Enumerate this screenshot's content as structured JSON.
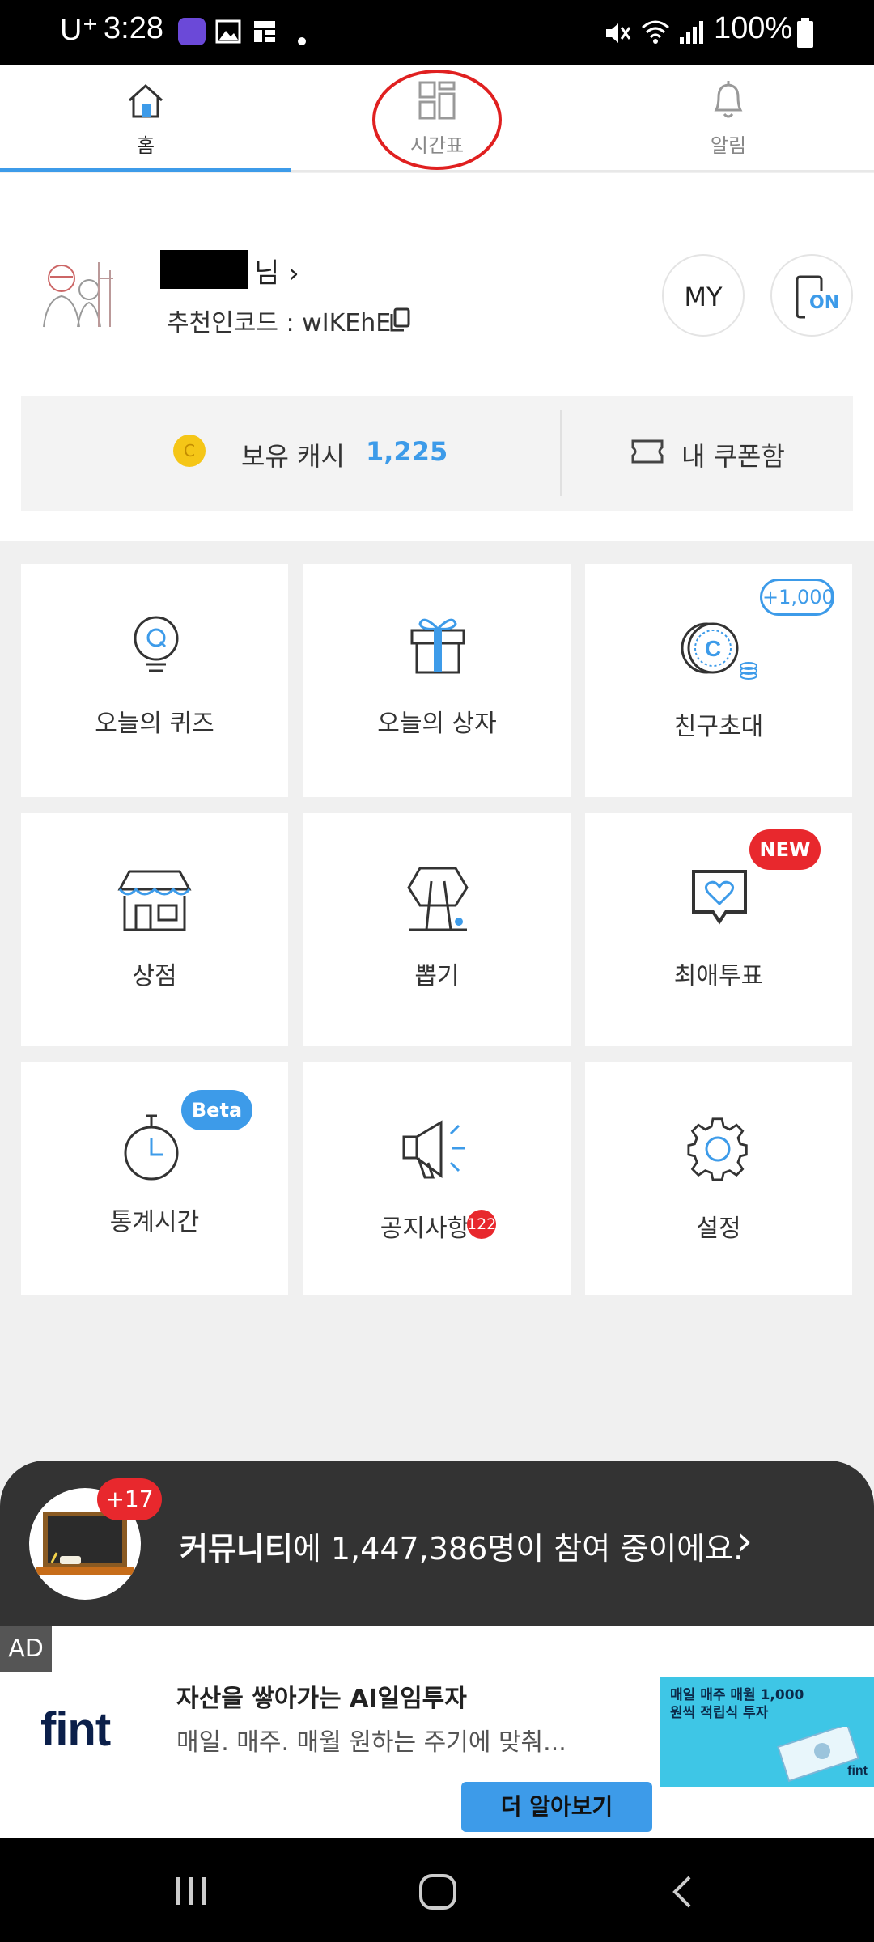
{
  "status_bar": {
    "carrier": "U⁺",
    "time": "3:28",
    "battery": "100%"
  },
  "tabs": [
    {
      "label": "홈",
      "icon": "home-icon",
      "active": true
    },
    {
      "label": "시간표",
      "icon": "timetable-icon",
      "active": false
    },
    {
      "label": "알림",
      "icon": "bell-icon",
      "active": false
    }
  ],
  "profile": {
    "name_suffix": "님 ›",
    "recommend_code": "추천인코드 : wIKEhE",
    "my_button": "MY",
    "on_button": "ON"
  },
  "cash": {
    "label": "보유 캐시",
    "value": "1,225",
    "coupon_label": "내 쿠폰함",
    "coin_symbol": "C"
  },
  "menu": [
    {
      "label": "오늘의 퀴즈",
      "icon": "quiz-bulb-icon"
    },
    {
      "label": "오늘의 상자",
      "icon": "gift-box-icon"
    },
    {
      "label": "친구초대",
      "icon": "coin-stack-icon",
      "badge": "+1,000"
    },
    {
      "label": "상점",
      "icon": "store-icon"
    },
    {
      "label": "뽑기",
      "icon": "claw-machine-icon"
    },
    {
      "label": "최애투표",
      "icon": "heart-vote-icon",
      "badge": "NEW"
    },
    {
      "label": "통계시간",
      "icon": "stopwatch-icon",
      "badge": "Beta"
    },
    {
      "label": "공지사항",
      "icon": "megaphone-icon",
      "badge": "122"
    },
    {
      "label": "설정",
      "icon": "settings-gear-icon"
    }
  ],
  "community": {
    "badge": "+17",
    "text_bold": "커뮤니티",
    "text_rest": "에 1,447,386명이 참여 중이에요.",
    "chevron": "›"
  },
  "ad": {
    "tag": "AD",
    "logo": "fint",
    "title": "자산을 쌓아가는 AI일임투자",
    "desc": "매일. 매주. 매월 원하는 주기에 맞춰...",
    "button": "더 알아보기",
    "banner_text": "매일 매주 매월 1,000원씩 적립식 투자",
    "banner_brand": "fint"
  },
  "colors": {
    "accent": "#3d9be9",
    "badge_red": "#e8282d",
    "annotation_red": "#e02020"
  }
}
